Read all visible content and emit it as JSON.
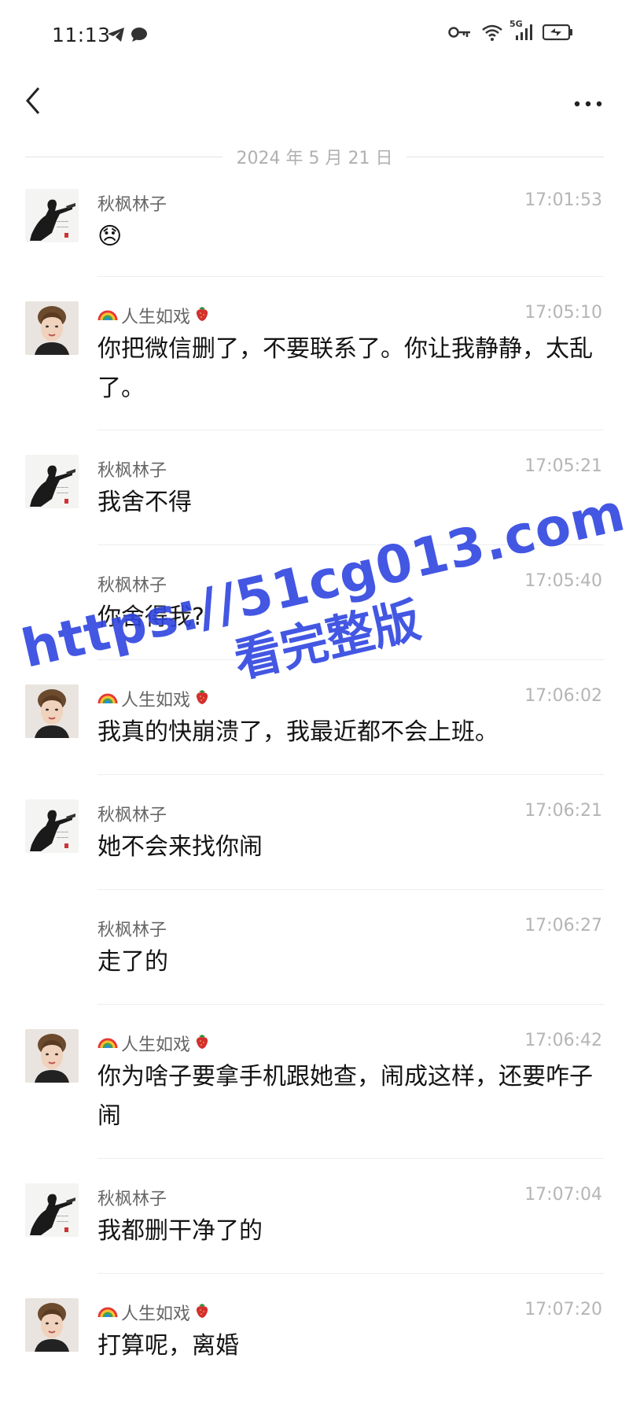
{
  "status_bar": {
    "time": "11:13",
    "network": "5G",
    "icons": [
      "telegram-icon",
      "chat-bubble-icon",
      "vpn-key-icon",
      "wifi-icon",
      "signal-icon",
      "battery-icon"
    ]
  },
  "nav": {
    "back_icon": "chevron-left-icon",
    "more_icon": "more-dots-icon"
  },
  "date_divider": "2024 年 5 月 21 日",
  "messages": [
    {
      "sender": "秋枫林子",
      "time": "17:01:53",
      "text": "😞",
      "show_avatar": true,
      "avatar": "male"
    },
    {
      "sender": "人生如戏",
      "time": "17:05:10",
      "text": "你把微信删了，不要联系了。你让我静静，太乱了。",
      "show_avatar": true,
      "avatar": "female"
    },
    {
      "sender": "秋枫林子",
      "time": "17:05:21",
      "text": "我舍不得",
      "show_avatar": true,
      "avatar": "male"
    },
    {
      "sender": "秋枫林子",
      "time": "17:05:40",
      "text": "你舍得我?",
      "show_avatar": false,
      "avatar": "male"
    },
    {
      "sender": "人生如戏",
      "time": "17:06:02",
      "text": "我真的快崩溃了，我最近都不会上班。",
      "show_avatar": true,
      "avatar": "female"
    },
    {
      "sender": "秋枫林子",
      "time": "17:06:21",
      "text": "她不会来找你闹",
      "show_avatar": true,
      "avatar": "male"
    },
    {
      "sender": "秋枫林子",
      "time": "17:06:27",
      "text": "走了的",
      "show_avatar": false,
      "avatar": "male"
    },
    {
      "sender": "人生如戏",
      "time": "17:06:42",
      "text": "你为啥子要拿手机跟她查，闹成这样，还要咋子闹",
      "show_avatar": true,
      "avatar": "female"
    },
    {
      "sender": "秋枫林子",
      "time": "17:07:04",
      "text": "我都删干净了的",
      "show_avatar": true,
      "avatar": "male"
    },
    {
      "sender": "人生如戏",
      "time": "17:07:20",
      "text": "打算呢，离婚",
      "show_avatar": true,
      "avatar": "female"
    }
  ],
  "watermark": {
    "line1": "https://51cg013.com",
    "line2": "看完整版"
  },
  "colors": {
    "watermark": "#2f45e0",
    "timestamp": "#b5b5b5",
    "name": "#666666"
  }
}
